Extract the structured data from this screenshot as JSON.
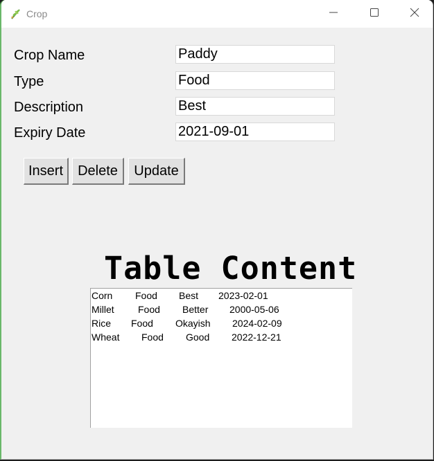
{
  "window": {
    "title": "Crop"
  },
  "form": {
    "crop_name_label": "Crop Name",
    "crop_name_value": "Paddy",
    "type_label": "Type",
    "type_value": "Food",
    "description_label": "Description",
    "description_value": "Best",
    "expiry_label": "Expiry Date",
    "expiry_value": "2021-09-01"
  },
  "buttons": {
    "insert": "Insert",
    "delete": "Delete",
    "update": "Update"
  },
  "table": {
    "heading": "Table Content",
    "rows": [
      {
        "name": "Corn",
        "type": "Food",
        "desc": "Best",
        "date": "2023-02-01"
      },
      {
        "name": "Millet",
        "type": "Food",
        "desc": "Better",
        "date": "2000-05-06"
      },
      {
        "name": "Rice",
        "type": "Food",
        "desc": "Okayish",
        "date": "2024-02-09"
      },
      {
        "name": "Wheat",
        "type": "Food",
        "desc": "Good",
        "date": "2022-12-21"
      }
    ]
  },
  "icons": {
    "app": "crop-plant-icon",
    "minimize": "minimize-icon",
    "maximize": "maximize-icon",
    "close": "close-icon"
  },
  "colors": {
    "window_bg": "#f0f0f0",
    "titlebar_bg": "#ffffff",
    "accent_border": "#6ab86a"
  }
}
